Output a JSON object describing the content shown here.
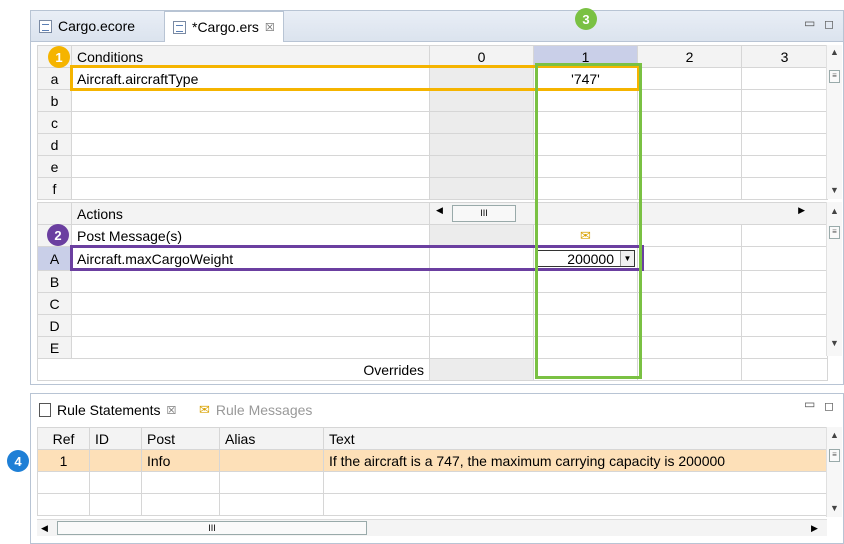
{
  "editor": {
    "tabs": [
      {
        "label": "Cargo.ecore"
      },
      {
        "label": "*Cargo.ers",
        "close": "☒"
      }
    ],
    "conditions": {
      "header_label": "Conditions",
      "columns": [
        "0",
        "1",
        "2",
        "3"
      ],
      "rows": [
        {
          "letter": "a",
          "text": "Aircraft.aircraftType",
          "col1": "'747'"
        },
        {
          "letter": "b",
          "text": ""
        },
        {
          "letter": "c",
          "text": ""
        },
        {
          "letter": "d",
          "text": ""
        },
        {
          "letter": "e",
          "text": ""
        },
        {
          "letter": "f",
          "text": ""
        }
      ]
    },
    "actions": {
      "header_label": "Actions",
      "post_label": "Post Message(s)",
      "rows": [
        {
          "letter": "A",
          "text": "Aircraft.maxCargoWeight",
          "col1": "200000"
        },
        {
          "letter": "B",
          "text": ""
        },
        {
          "letter": "C",
          "text": ""
        },
        {
          "letter": "D",
          "text": ""
        },
        {
          "letter": "E",
          "text": ""
        }
      ],
      "overrides_label": "Overrides"
    },
    "hscroll_grip": "III"
  },
  "bottom": {
    "tabs": [
      {
        "label": "Rule Statements",
        "close": "☒"
      },
      {
        "label": "Rule Messages"
      }
    ],
    "columns": [
      "Ref",
      "ID",
      "Post",
      "Alias",
      "Text"
    ],
    "rows": [
      {
        "ref": "1",
        "id": "",
        "post": "Info",
        "alias": "",
        "text": "If the aircraft is a 747, the maximum carrying capacity is 200000"
      }
    ],
    "hscroll_grip": "III"
  },
  "callouts": [
    "1",
    "2",
    "3",
    "4"
  ],
  "colors": {
    "callout1": "#f5b400",
    "callout2": "#6b3fa0",
    "callout3": "#7ac143",
    "callout4": "#1e7fd6",
    "selected_column": "#c9cfe8",
    "statement_row": "#fde0b8"
  }
}
